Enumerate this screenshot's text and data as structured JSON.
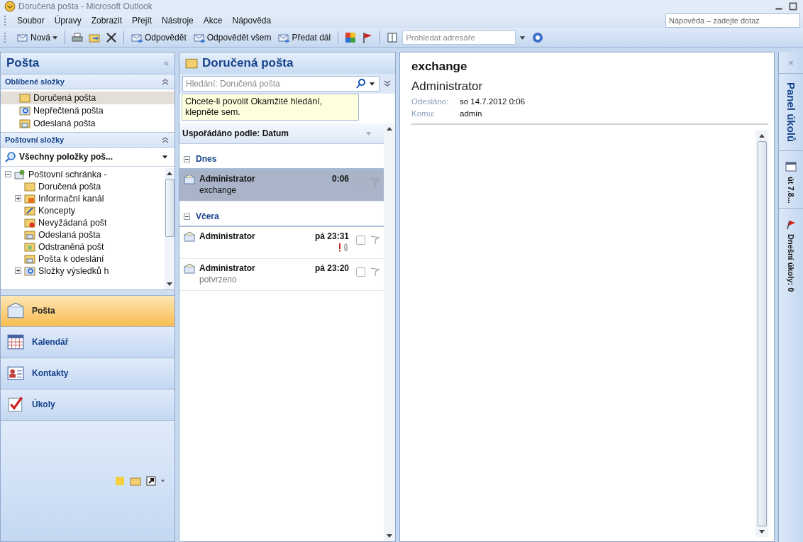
{
  "window": {
    "title": "Doručená pošta - Microsoft Outlook"
  },
  "menu": [
    {
      "label": "Soubor"
    },
    {
      "label": "Úpravy"
    },
    {
      "label": "Zobrazit"
    },
    {
      "label": "Přejít"
    },
    {
      "label": "Nástroje"
    },
    {
      "label": "Akce"
    },
    {
      "label": "Nápověda"
    }
  ],
  "help_search": {
    "placeholder": "Nápověda – zadejte dotaz"
  },
  "toolbar": [
    {
      "kind": "new",
      "label": "Nová"
    },
    {
      "kind": "sep"
    },
    {
      "kind": "print"
    },
    {
      "kind": "move"
    },
    {
      "kind": "delete"
    },
    {
      "kind": "sep"
    },
    {
      "kind": "reply",
      "label": "Odpovědět"
    },
    {
      "kind": "replyall",
      "label": "Odpovědět všem"
    },
    {
      "kind": "forward",
      "label": "Předat dál"
    },
    {
      "kind": "sep"
    },
    {
      "kind": "categories"
    },
    {
      "kind": "flag"
    },
    {
      "kind": "sep"
    },
    {
      "kind": "book"
    },
    {
      "kind": "search",
      "placeholder": "Prohledat adresáře"
    },
    {
      "kind": "help"
    }
  ],
  "nav": {
    "title": "Pošta",
    "collapse": "«",
    "favorites": {
      "title": "Oblíbené složky",
      "items": [
        {
          "label": "Doručená pošta",
          "kind": "inbox",
          "selected": true
        },
        {
          "label": "Nepřečtená pošta",
          "kind": "searchfolder",
          "selected": false
        },
        {
          "label": "Odeslaná pošta",
          "kind": "sent",
          "selected": false
        }
      ]
    },
    "folders_title": "Poštovní složky",
    "view": "Všechny položky poš...",
    "tree": [
      {
        "label": "Poštovní schránka -",
        "expanded": true,
        "children": [
          {
            "label": "Doručená pošta",
            "kind": "inbox"
          },
          {
            "label": "Informační kanál",
            "kind": "rss",
            "expanded": false
          },
          {
            "label": "Koncepty",
            "kind": "drafts"
          },
          {
            "label": "Nevyžádaná pošt",
            "kind": "junk"
          },
          {
            "label": "Odeslaná pošta",
            "kind": "sent"
          },
          {
            "label": "Odstraněná pošt",
            "kind": "deleted"
          },
          {
            "label": "Pošta k odeslání",
            "kind": "outbox"
          },
          {
            "label": "Složky výsledků h",
            "kind": "searchfolder",
            "expanded": false
          }
        ]
      }
    ],
    "buttons": [
      {
        "label": "Pošta",
        "kind": "mail",
        "selected": true
      },
      {
        "label": "Kalendář",
        "kind": "calendar",
        "selected": false
      },
      {
        "label": "Kontakty",
        "kind": "contacts",
        "selected": false
      },
      {
        "label": "Úkoly",
        "kind": "tasks",
        "selected": false
      }
    ]
  },
  "list": {
    "title": "Doručená pošta",
    "search": {
      "placeholder": "Hledání: Doručená pošta"
    },
    "hint": "Chcete-li povolit Okamžité hledání, klepněte sem.",
    "arrange": "Uspořádáno podle: Datum",
    "groups": [
      {
        "label": "Dnes",
        "expanded": true,
        "items": [
          {
            "sender": "Administrator",
            "time": "0:06",
            "subject": "exchange",
            "selected": true,
            "important": false,
            "attachment": false
          }
        ]
      },
      {
        "label": "Včera",
        "expanded": true,
        "items": [
          {
            "sender": "Administrator",
            "time": "pá 23:31",
            "selected": false,
            "important": true,
            "attachment": true
          },
          {
            "sender": "Administrator",
            "time": "pá 23:20",
            "subject": "potvrzeno",
            "selected": false,
            "important": false,
            "attachment": false
          }
        ]
      }
    ]
  },
  "reading": {
    "subject": "exchange",
    "sender": "Administrator",
    "fields": [
      {
        "label": "Odesláno:",
        "value": "so 14.7.2012 0:06"
      },
      {
        "label": "Komu:",
        "value": "admin"
      }
    ]
  },
  "task_bar": {
    "collapse": "«",
    "title": "Panel úkolů",
    "date": "út 7.8...",
    "tasks": "Dnešní úkoly: 0"
  }
}
